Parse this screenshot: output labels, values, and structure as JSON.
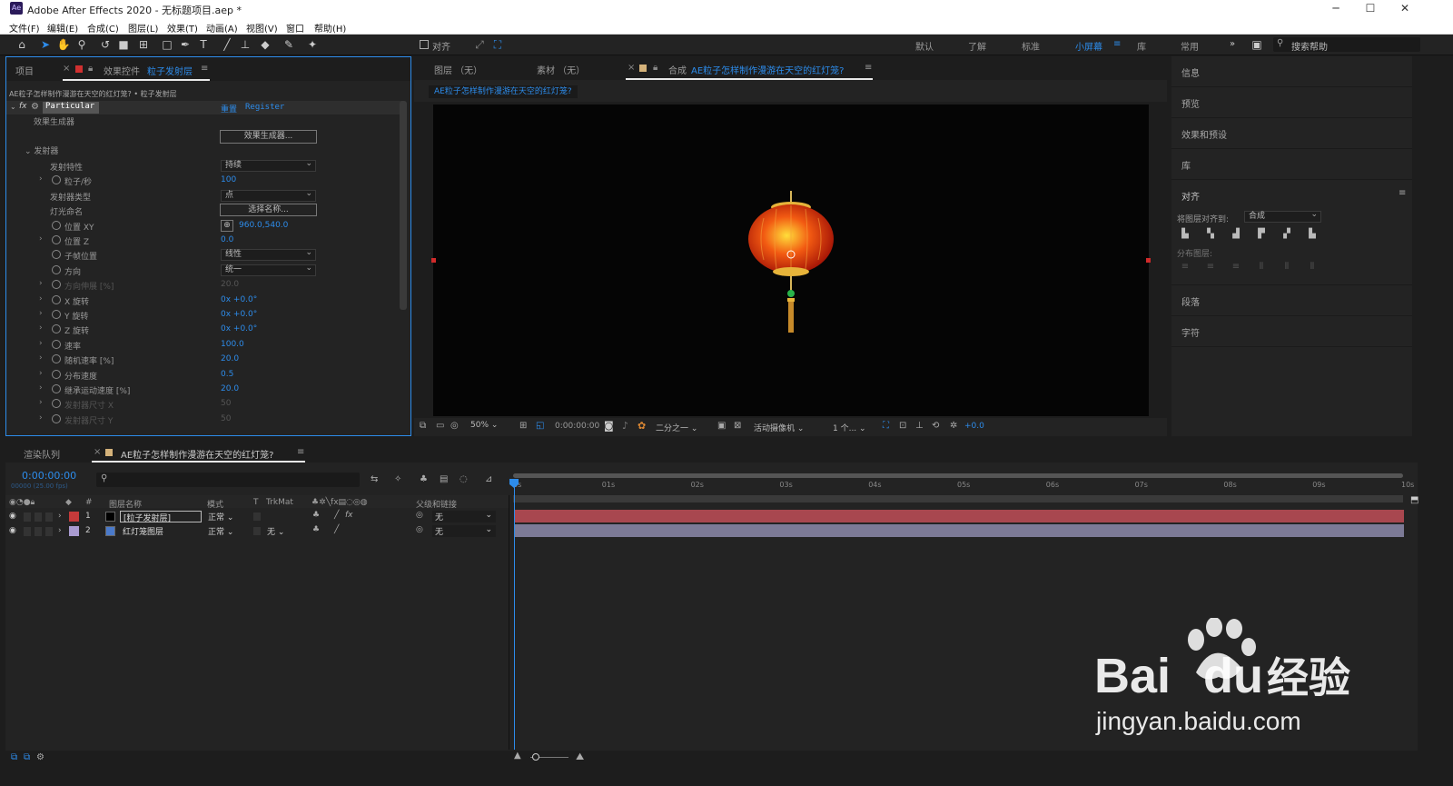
{
  "window": {
    "title": "Adobe After Effects 2020 - 无标题项目.aep *",
    "app_badge": "Ae",
    "min": "─",
    "max": "☐",
    "close": "✕"
  },
  "menu": [
    "文件(F)",
    "编辑(E)",
    "合成(C)",
    "图层(L)",
    "效果(T)",
    "动画(A)",
    "视图(V)",
    "窗口",
    "帮助(H)"
  ],
  "toolbar": {
    "align_label": "对齐",
    "workspaces": [
      "默认",
      "了解",
      "标准",
      "小屏幕",
      "库",
      "常用"
    ],
    "active_workspace": "小屏幕",
    "search_placeholder": "搜索帮助",
    "more": "»"
  },
  "effect_controls": {
    "tab_project": "项目",
    "tab_prefix": "效果控件",
    "tab_layer": "粒子发射层",
    "breadcrumb": "AE粒子怎样制作漫游在天空的红灯笼? • 粒子发射层",
    "effect_name": "Particular",
    "reset": "重置",
    "register": "Register",
    "designer_label": "效果生成器",
    "designer_button": "效果生成器...",
    "emitter_group": "发射器",
    "rows": [
      {
        "label": "发射特性",
        "type": "dropdown",
        "value": "持续"
      },
      {
        "label": "粒子/秒",
        "type": "num",
        "value": "100",
        "stopwatch": true,
        "expand": true
      },
      {
        "label": "发射器类型",
        "type": "dropdown",
        "value": "点"
      },
      {
        "label": "灯光命名",
        "type": "button",
        "value": "选择名称..."
      },
      {
        "label": "位置 XY",
        "type": "point",
        "value": "960.0,540.0",
        "stopwatch": true
      },
      {
        "label": "位置 Z",
        "type": "num",
        "value": "0.0",
        "stopwatch": true,
        "expand": true
      },
      {
        "label": "子帧位置",
        "type": "dropdown",
        "value": "线性",
        "stopwatch": true
      },
      {
        "label": "方向",
        "type": "dropdown",
        "value": "统一",
        "stopwatch": true
      },
      {
        "label": "方向伸展 [%]",
        "type": "num",
        "value": "20.0",
        "stopwatch": true,
        "expand": true,
        "dim": true
      },
      {
        "label": "X 旋转",
        "type": "num",
        "value": "0x +0.0°",
        "stopwatch": true,
        "expand": true
      },
      {
        "label": "Y 旋转",
        "type": "num",
        "value": "0x +0.0°",
        "stopwatch": true,
        "expand": true
      },
      {
        "label": "Z 旋转",
        "type": "num",
        "value": "0x +0.0°",
        "stopwatch": true,
        "expand": true
      },
      {
        "label": "速率",
        "type": "num",
        "value": "100.0",
        "stopwatch": true,
        "expand": true
      },
      {
        "label": "随机速率 [%]",
        "type": "num",
        "value": "20.0",
        "stopwatch": true,
        "expand": true
      },
      {
        "label": "分布速度",
        "type": "num",
        "value": "0.5",
        "stopwatch": true,
        "expand": true
      },
      {
        "label": "继承运动速度 [%]",
        "type": "num",
        "value": "20.0",
        "stopwatch": true,
        "expand": true
      },
      {
        "label": "发射器尺寸 X",
        "type": "num",
        "value": "50",
        "stopwatch": true,
        "expand": true,
        "dim": true
      },
      {
        "label": "发射器尺寸 Y",
        "type": "num",
        "value": "50",
        "stopwatch": true,
        "expand": true,
        "dim": true
      }
    ]
  },
  "viewer": {
    "tab_layer": "图层 （无）",
    "tab_footage": "素材 （无）",
    "tab_comp_prefix": "合成",
    "comp_name": "AE粒子怎样制作漫游在天空的红灯笼?",
    "comp_tab_label": "AE粒子怎样制作漫游在天空的红灯笼?",
    "zoom": "50%",
    "timecode": "0:00:00:00",
    "resolution": "二分之一",
    "camera": "活动摄像机",
    "views": "1 个...",
    "exposure": "+0.0"
  },
  "right_panels": {
    "items": [
      "信息",
      "预览",
      "效果和预设",
      "库"
    ],
    "align_title": "对齐",
    "align_to_label": "将图层对齐到:",
    "align_to_value": "合成",
    "distribute_label": "分布图层:",
    "items2": [
      "段落",
      "字符"
    ]
  },
  "timeline": {
    "tab_render": "渲染队列",
    "tab_comp": "AE粒子怎样制作漫游在天空的红灯笼?",
    "timecode": "0:00:00:00",
    "fps": "00000 (25.00 fps)",
    "search_placeholder": "",
    "columns": {
      "name": "图层名称",
      "mode": "模式",
      "t": "T",
      "trkmat": "TrkMat",
      "parent": "父级和链接"
    },
    "layers": [
      {
        "num": "1",
        "name": "[粒子发射层]",
        "mode": "正常",
        "trkmat": "",
        "parent": "无",
        "color": "#c43a3a",
        "bar": "#a8474f"
      },
      {
        "num": "2",
        "name": "红灯笼图层",
        "mode": "正常",
        "trkmat": "无",
        "parent": "无",
        "color": "#a99bd0",
        "bar": "#7c7a96"
      }
    ],
    "ruler": [
      "0s",
      "01s",
      "02s",
      "03s",
      "04s",
      "05s",
      "06s",
      "07s",
      "08s",
      "09s",
      "10s"
    ]
  },
  "watermark": {
    "brand": "Bai",
    "brand2": "du",
    "cn": "经验",
    "url": "jingyan.baidu.com"
  }
}
